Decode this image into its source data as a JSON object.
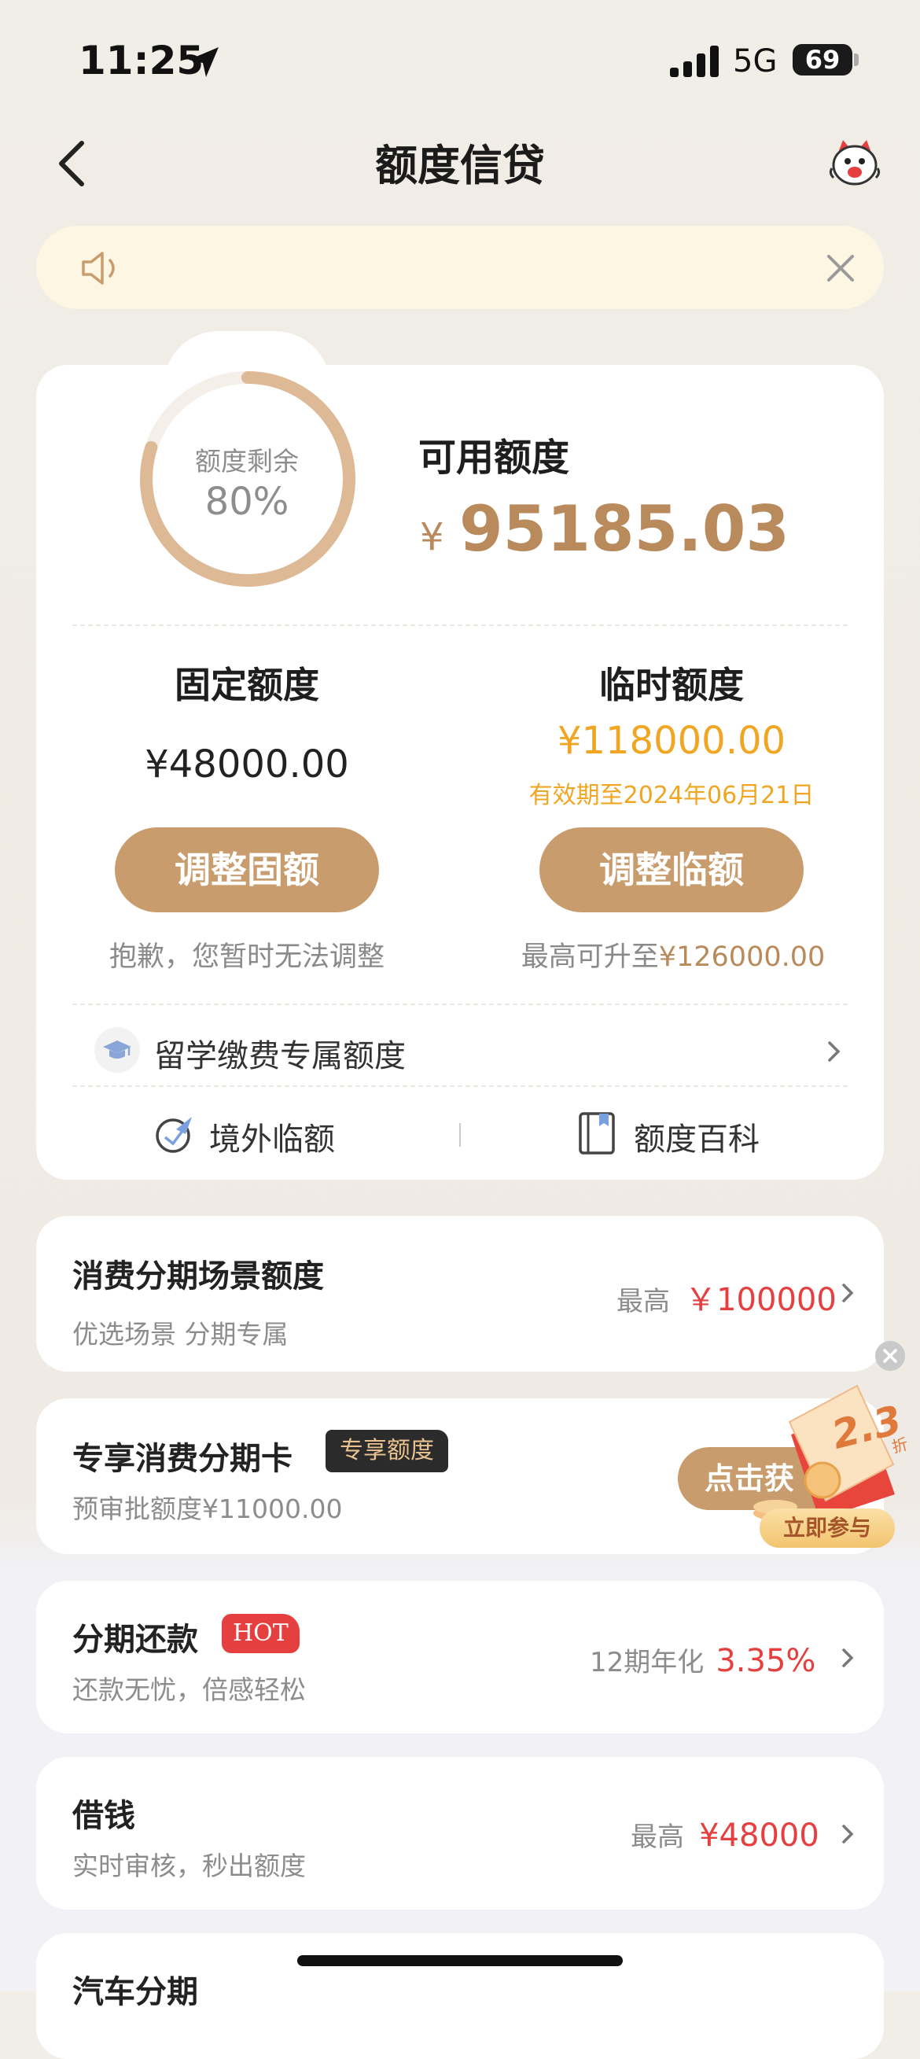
{
  "status_bar": {
    "time": "11:25",
    "network": "5G",
    "battery": "69"
  },
  "nav": {
    "title": "额度信贷"
  },
  "credit": {
    "ring_label": "额度剩余",
    "ring_percent": "80%",
    "ring_fraction": 0.8,
    "available_label": "可用额度",
    "currency": "¥",
    "available_amount": "95185.03"
  },
  "fixed": {
    "label": "固定额度",
    "amount": "¥48000.00",
    "button": "调整固额",
    "note": "抱歉，您暂时无法调整"
  },
  "temp": {
    "label": "临时额度",
    "amount": "¥118000.00",
    "validity": "有效期至2024年06月21日",
    "button": "调整临额",
    "note_prefix": "最高可升至",
    "note_amount": "¥126000.00"
  },
  "study": {
    "label": "留学缴费专属额度"
  },
  "links": {
    "overseas": "境外临额",
    "wiki": "额度百科"
  },
  "rows": {
    "consumer": {
      "title": "消费分期场景额度",
      "sub": "优选场景 分期专属",
      "right_label": "最高",
      "right_value": "￥100000"
    },
    "card": {
      "title": "专享消费分期卡",
      "badge": "专享额度",
      "sub": "预审批额度¥11000.00",
      "button": "点击获"
    },
    "installment": {
      "title": "分期还款",
      "badge": "HOT",
      "sub": "还款无忧，倍感轻松",
      "right_label": "12期年化",
      "right_value": "3.35%"
    },
    "borrow": {
      "title": "借钱",
      "sub": "实时审核，秒出额度",
      "right_label": "最高",
      "right_value": "¥48000"
    },
    "auto": {
      "title": "汽车分期"
    }
  },
  "promo": {
    "discount": "2.3",
    "discount_unit": "折",
    "join": "立即参与"
  },
  "colors": {
    "brand": "#c89c6c",
    "accent_red": "#e5403f",
    "gold": "#f0a623"
  }
}
